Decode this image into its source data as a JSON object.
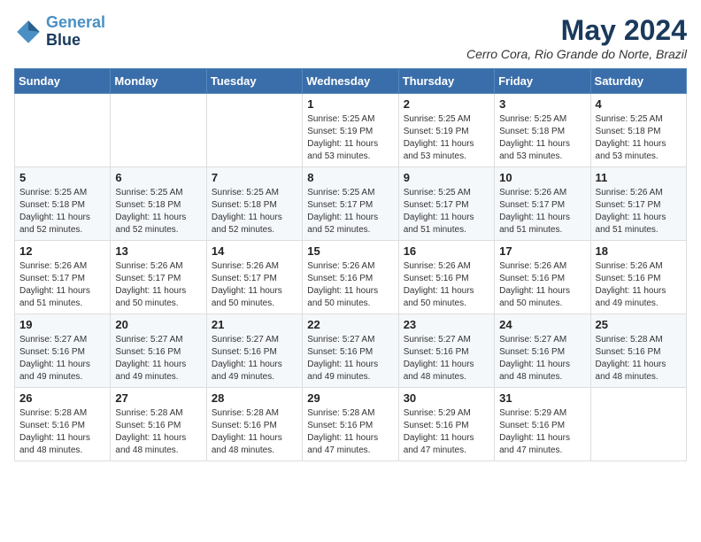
{
  "logo": {
    "line1": "General",
    "line2": "Blue"
  },
  "title": "May 2024",
  "location": "Cerro Cora, Rio Grande do Norte, Brazil",
  "weekdays": [
    "Sunday",
    "Monday",
    "Tuesday",
    "Wednesday",
    "Thursday",
    "Friday",
    "Saturday"
  ],
  "weeks": [
    [
      {
        "day": "",
        "sunrise": "",
        "sunset": "",
        "daylight": ""
      },
      {
        "day": "",
        "sunrise": "",
        "sunset": "",
        "daylight": ""
      },
      {
        "day": "",
        "sunrise": "",
        "sunset": "",
        "daylight": ""
      },
      {
        "day": "1",
        "sunrise": "5:25 AM",
        "sunset": "5:19 PM",
        "daylight": "11 hours and 53 minutes."
      },
      {
        "day": "2",
        "sunrise": "5:25 AM",
        "sunset": "5:19 PM",
        "daylight": "11 hours and 53 minutes."
      },
      {
        "day": "3",
        "sunrise": "5:25 AM",
        "sunset": "5:18 PM",
        "daylight": "11 hours and 53 minutes."
      },
      {
        "day": "4",
        "sunrise": "5:25 AM",
        "sunset": "5:18 PM",
        "daylight": "11 hours and 53 minutes."
      }
    ],
    [
      {
        "day": "5",
        "sunrise": "5:25 AM",
        "sunset": "5:18 PM",
        "daylight": "11 hours and 52 minutes."
      },
      {
        "day": "6",
        "sunrise": "5:25 AM",
        "sunset": "5:18 PM",
        "daylight": "11 hours and 52 minutes."
      },
      {
        "day": "7",
        "sunrise": "5:25 AM",
        "sunset": "5:18 PM",
        "daylight": "11 hours and 52 minutes."
      },
      {
        "day": "8",
        "sunrise": "5:25 AM",
        "sunset": "5:17 PM",
        "daylight": "11 hours and 52 minutes."
      },
      {
        "day": "9",
        "sunrise": "5:25 AM",
        "sunset": "5:17 PM",
        "daylight": "11 hours and 51 minutes."
      },
      {
        "day": "10",
        "sunrise": "5:26 AM",
        "sunset": "5:17 PM",
        "daylight": "11 hours and 51 minutes."
      },
      {
        "day": "11",
        "sunrise": "5:26 AM",
        "sunset": "5:17 PM",
        "daylight": "11 hours and 51 minutes."
      }
    ],
    [
      {
        "day": "12",
        "sunrise": "5:26 AM",
        "sunset": "5:17 PM",
        "daylight": "11 hours and 51 minutes."
      },
      {
        "day": "13",
        "sunrise": "5:26 AM",
        "sunset": "5:17 PM",
        "daylight": "11 hours and 50 minutes."
      },
      {
        "day": "14",
        "sunrise": "5:26 AM",
        "sunset": "5:17 PM",
        "daylight": "11 hours and 50 minutes."
      },
      {
        "day": "15",
        "sunrise": "5:26 AM",
        "sunset": "5:16 PM",
        "daylight": "11 hours and 50 minutes."
      },
      {
        "day": "16",
        "sunrise": "5:26 AM",
        "sunset": "5:16 PM",
        "daylight": "11 hours and 50 minutes."
      },
      {
        "day": "17",
        "sunrise": "5:26 AM",
        "sunset": "5:16 PM",
        "daylight": "11 hours and 50 minutes."
      },
      {
        "day": "18",
        "sunrise": "5:26 AM",
        "sunset": "5:16 PM",
        "daylight": "11 hours and 49 minutes."
      }
    ],
    [
      {
        "day": "19",
        "sunrise": "5:27 AM",
        "sunset": "5:16 PM",
        "daylight": "11 hours and 49 minutes."
      },
      {
        "day": "20",
        "sunrise": "5:27 AM",
        "sunset": "5:16 PM",
        "daylight": "11 hours and 49 minutes."
      },
      {
        "day": "21",
        "sunrise": "5:27 AM",
        "sunset": "5:16 PM",
        "daylight": "11 hours and 49 minutes."
      },
      {
        "day": "22",
        "sunrise": "5:27 AM",
        "sunset": "5:16 PM",
        "daylight": "11 hours and 49 minutes."
      },
      {
        "day": "23",
        "sunrise": "5:27 AM",
        "sunset": "5:16 PM",
        "daylight": "11 hours and 48 minutes."
      },
      {
        "day": "24",
        "sunrise": "5:27 AM",
        "sunset": "5:16 PM",
        "daylight": "11 hours and 48 minutes."
      },
      {
        "day": "25",
        "sunrise": "5:28 AM",
        "sunset": "5:16 PM",
        "daylight": "11 hours and 48 minutes."
      }
    ],
    [
      {
        "day": "26",
        "sunrise": "5:28 AM",
        "sunset": "5:16 PM",
        "daylight": "11 hours and 48 minutes."
      },
      {
        "day": "27",
        "sunrise": "5:28 AM",
        "sunset": "5:16 PM",
        "daylight": "11 hours and 48 minutes."
      },
      {
        "day": "28",
        "sunrise": "5:28 AM",
        "sunset": "5:16 PM",
        "daylight": "11 hours and 48 minutes."
      },
      {
        "day": "29",
        "sunrise": "5:28 AM",
        "sunset": "5:16 PM",
        "daylight": "11 hours and 47 minutes."
      },
      {
        "day": "30",
        "sunrise": "5:29 AM",
        "sunset": "5:16 PM",
        "daylight": "11 hours and 47 minutes."
      },
      {
        "day": "31",
        "sunrise": "5:29 AM",
        "sunset": "5:16 PM",
        "daylight": "11 hours and 47 minutes."
      },
      {
        "day": "",
        "sunrise": "",
        "sunset": "",
        "daylight": ""
      }
    ]
  ]
}
